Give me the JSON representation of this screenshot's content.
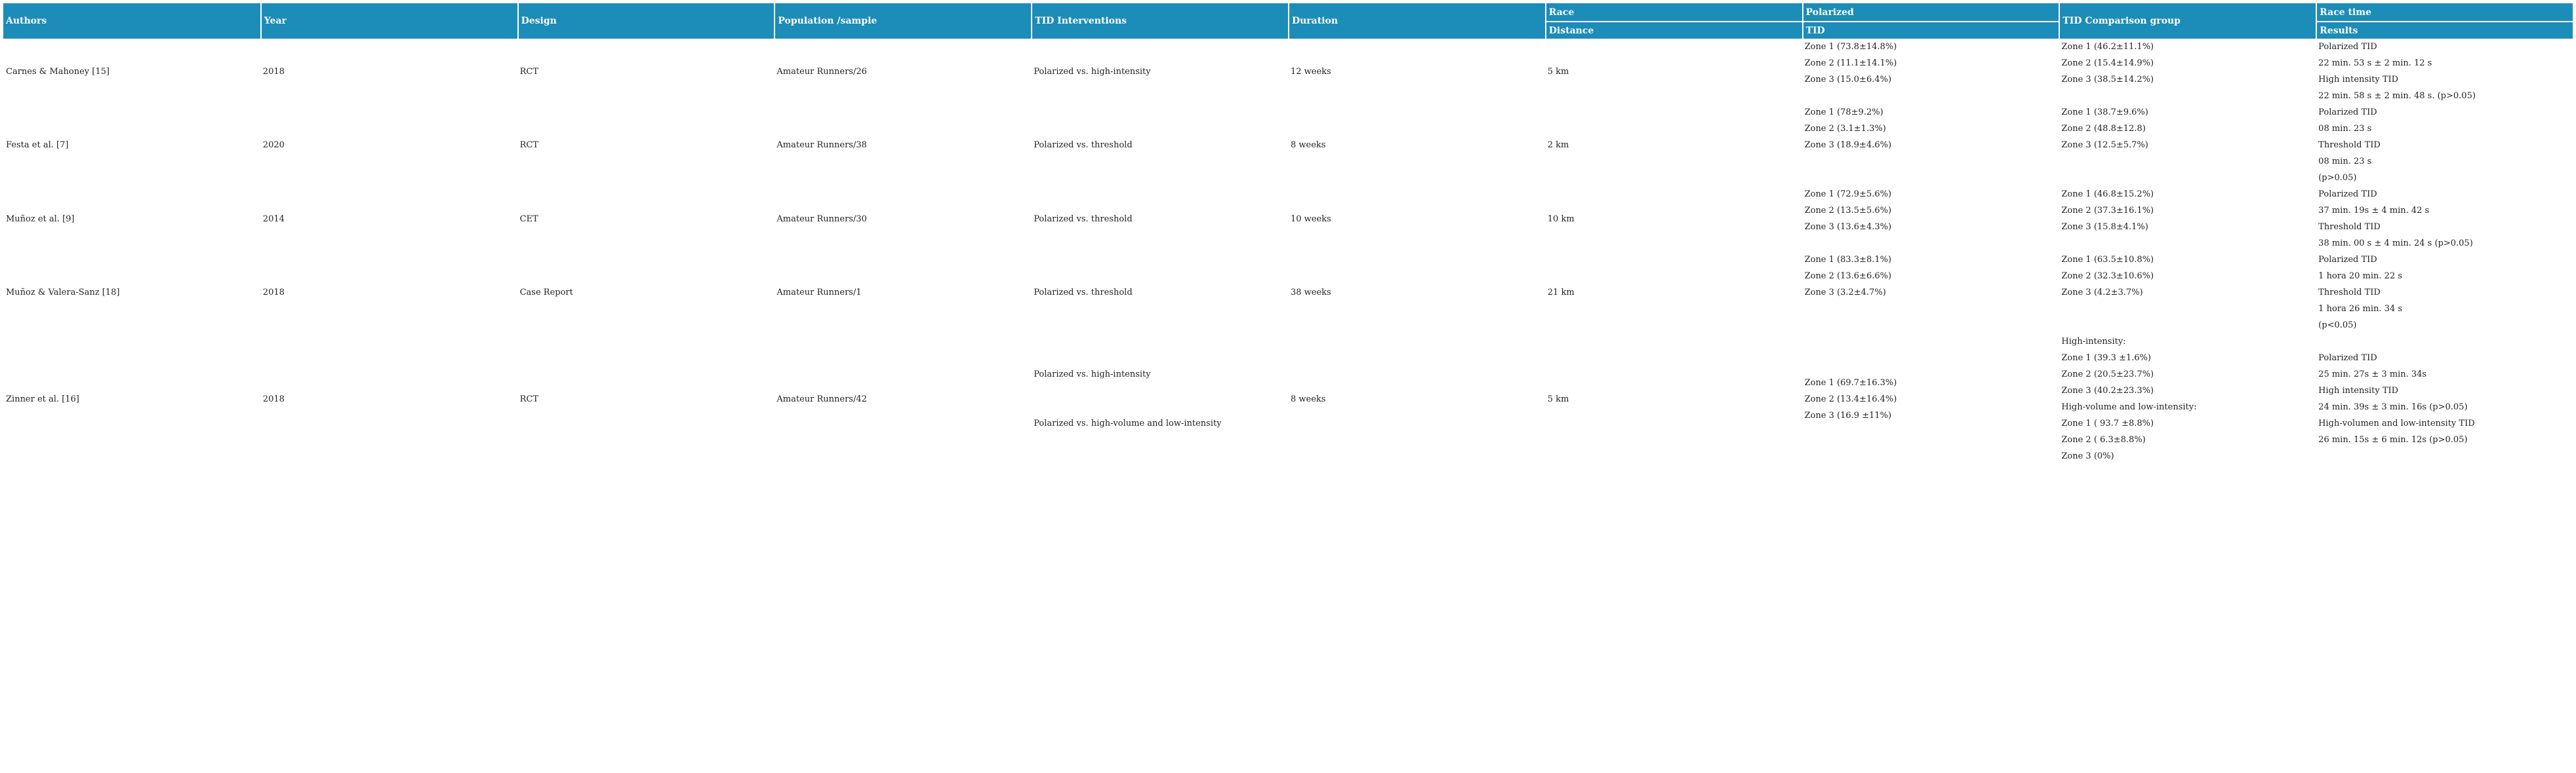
{
  "headers": {
    "authors": "Authors",
    "year": "Year",
    "design": "Design",
    "population": "Population /sample",
    "tid_interventions": "TID Interventions",
    "duration": "Duration",
    "race": "Race",
    "distance": "Distance",
    "polarized": "Polarized",
    "tid": "TID",
    "tid_comparison": "TID Comparison group",
    "race_time": "Race time",
    "results": "Results"
  },
  "rows": [
    {
      "authors": "Carnes & Mahoney [15]",
      "year": "2018",
      "design": "RCT",
      "population": "Amateur Runners/26",
      "intervention": "Polarized vs. high-intensity",
      "duration": "12 weeks",
      "distance": "5 km",
      "polarized_tid": [
        "Zone 1 (73.8±14.8%)",
        "Zone 2 (11.1±14.1%)",
        "Zone 3 (15.0±6.4%)"
      ],
      "comparison_tid": [
        "Zone 1 (46.2±11.1%)",
        "Zone 2 (15.4±14.9%)",
        "Zone 3 (38.5±14.2%)"
      ],
      "results": [
        "Polarized TID",
        "22 min. 53 s ± 2 min. 12 s",
        "High intensity TID",
        "22 min. 58 s ± 2 min. 48 s. (p>0.05)"
      ]
    },
    {
      "authors": "Festa et al. [7]",
      "year": "2020",
      "design": "RCT",
      "population": "Amateur Runners/38",
      "intervention": "Polarized vs. threshold",
      "duration": "8 weeks",
      "distance": "2 km",
      "polarized_tid": [
        "Zone 1 (78±9.2%)",
        "Zone 2 (3.1±1.3%)",
        "Zone 3 (18.9±4.6%)"
      ],
      "comparison_tid": [
        "Zone 1 (38.7±9.6%)",
        "Zone 2 (48.8±12.8)",
        "Zone 3 (12.5±5.7%)"
      ],
      "results": [
        "Polarized TID",
        "08 min. 23 s",
        "Threshold TID",
        "08 min. 23 s",
        "(p>0.05)"
      ]
    },
    {
      "authors": "Muñoz et al. [9]",
      "year": "2014",
      "design": "CET",
      "population": "Amateur Runners/30",
      "intervention": "Polarized vs. threshold",
      "duration": "10 weeks",
      "distance": "10 km",
      "polarized_tid": [
        "Zone 1 (72.9±5.6%)",
        "Zone 2 (13.5±5.6%)",
        "Zone 3 (13.6±4.3%)"
      ],
      "comparison_tid": [
        "Zone 1 (46.8±15.2%)",
        "Zone 2 (37.3±16.1%)",
        "Zone 3 (15.8±4.1%)"
      ],
      "results": [
        "Polarized TID",
        "37 min. 19s ± 4 min. 42 s",
        "Threshold TID",
        "38 min. 00 s ± 4 min. 24 s (p>0.05)"
      ]
    },
    {
      "authors": "Muñoz & Valera-Sanz [18]",
      "year": "2018",
      "design": "Case Report",
      "population": "Amateur Runners/1",
      "intervention": "Polarized vs. threshold",
      "duration": "38 weeks",
      "distance": "21 km",
      "polarized_tid": [
        "Zone 1 (83.3±8.1%)",
        "Zone 2 (13.6±6.6%)",
        "Zone 3 (3.2±4.7%)"
      ],
      "comparison_tid": [
        "Zone 1 (63.5±10.8%)",
        "Zone 2 (32.3±10.6%)",
        "Zone 3 (4.2±3.7%)"
      ],
      "results": [
        "Polarized TID",
        "1 hora 20 min. 22 s",
        "Threshold TID",
        "1 hora 26 min. 34 s",
        "(p<0.05)"
      ]
    },
    {
      "authors": "Zinner et al. [16]",
      "year": "2018",
      "design": "RCT",
      "population": "Amateur Runners/42",
      "intervention_a": "Polarized vs. high-intensity",
      "intervention_b": "Polarized vs. high-volume and low-intensity",
      "duration": "8 weeks",
      "distance": "5 km",
      "polarized_tid": [
        "Zone 1 (69.7±16.3%)",
        "Zone 2 (13.4±16.4%)",
        "Zone 3 (16.9 ±11%)"
      ],
      "comparison_tid": [
        "High-intensity:",
        "Zone 1 (39.3 ±1.6%)",
        "Zone 2 (20.5±23.7%)",
        "Zone 3 (40.2±23.3%)",
        "High-volume and low-intensity:",
        "Zone 1 ( 93.7 ±8.8%)",
        "Zone 2 ( 6.3±8.8%)",
        "Zone 3 (0%)"
      ],
      "results": [
        "Polarized TID",
        "25 min. 27s ± 3 min. 34s",
        "High intensity TID",
        "24 min. 39s ± 3 min. 16s (p>0.05)",
        "High-volumen and low-intensity TID",
        "26 min. 15s ± 6 min. 12s (p>0.05)"
      ]
    }
  ]
}
